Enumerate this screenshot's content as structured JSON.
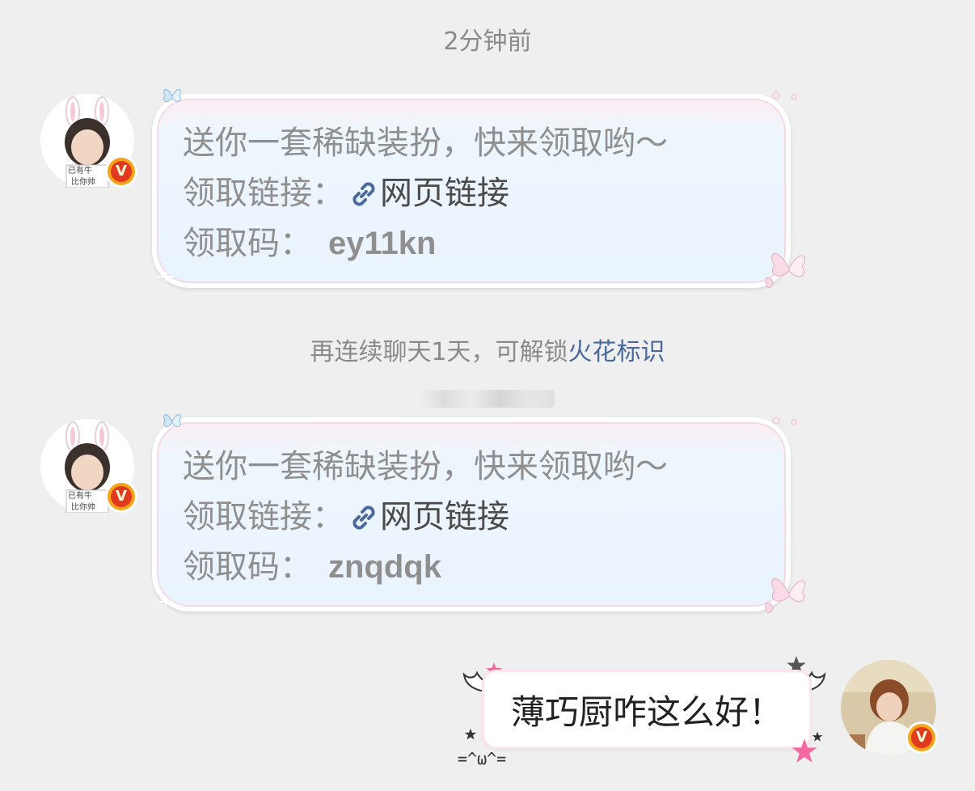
{
  "timestamp": "2分钟前",
  "messages": [
    {
      "line1": "送你一套稀缺装扮，快来领取哟～",
      "link_prefix": "领取链接：",
      "link_text": "网页链接",
      "code_prefix": "领取码：",
      "code": "ey11kn"
    },
    {
      "line1": "送你一套稀缺装扮，快来领取哟～",
      "link_prefix": "领取链接：",
      "link_text": "网页链接",
      "code_prefix": "领取码：",
      "code": "znqdqk"
    }
  ],
  "system_note": {
    "text": "再连续聊天1天，可解锁",
    "highlight": "火花标识"
  },
  "my_message": "薄巧厨咋这么好！",
  "kaomoji": "=^ω^=",
  "avatar_sign": "已有牛 比你帅",
  "badge_letter": "V",
  "colors": {
    "background": "#efeff0",
    "bubble_fill": "#eaf4fd",
    "bubble_border_pink": "#f3dbe6",
    "link_blue": "#4a6a9c",
    "badge_orange": "#f7a41b",
    "badge_red": "#e0391d",
    "star_pink": "#f46aa0",
    "star_gray": "#555555"
  },
  "icons": [
    "link-icon",
    "butterfly-icon",
    "star-icon",
    "wing-icon",
    "sparkle-icon"
  ]
}
